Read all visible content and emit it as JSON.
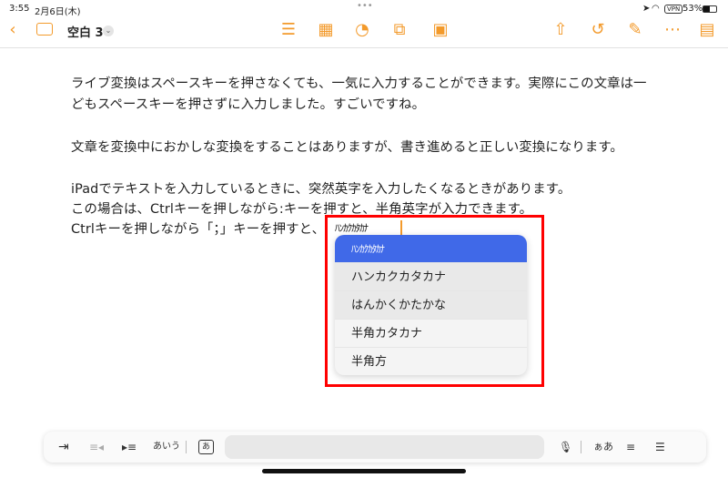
{
  "status": {
    "time": "3:55",
    "date": "2月6日(木)",
    "vpn": "VPN",
    "battery": "53%"
  },
  "toolbar": {
    "doc_title": "空白 3"
  },
  "document": {
    "lines": [
      "ライブ変換はスペースキーを押さなくても、一気に入力することができます。実際にこの文章は一",
      "どもスペースキーを押さずに入力しました。すごいですね。",
      "文章を変換中におかしな変換をすることはありますが、書き進めると正しい変換になります。",
      "iPadでテキストを入力しているときに、突然英字を入力したくなるときがあります。",
      "この場合は、Ctrlキーを押しながら:キーを押すと、半角英字が入力できます。",
      "Ctrlキーを押しながら「；」キーを押すと、"
    ],
    "composing": "ﾊﾝｶｸｶﾀｶﾅ"
  },
  "candidates": [
    "ﾊﾝｶｸｶﾀｶﾅ",
    "ハンカクカタカナ",
    "はんかくかたかな",
    "半角カタカナ",
    "半角方"
  ],
  "keyboard_bar": {
    "kana": "あいう",
    "input_mode": "あ",
    "small_kana": "ぁあ"
  },
  "colors": {
    "accent": "#f39a2b",
    "selection": "#4069e8",
    "highlight_box": "#ff0000"
  }
}
